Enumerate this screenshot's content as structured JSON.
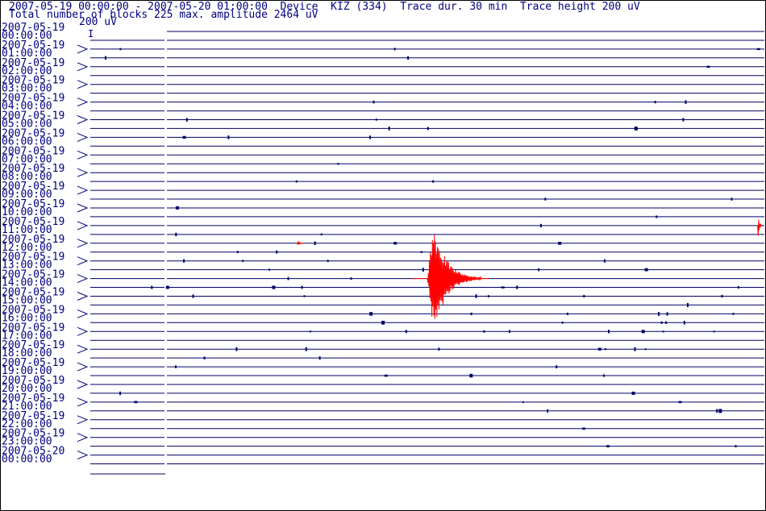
{
  "header": {
    "line1": "2007-05-19 00:00:00 - 2007-05-20 01:00:00  Device  KIZ (334)  Trace dur. 30 min  Trace height 200 uV",
    "line2": "Total number of blocks 225 max. amplitude 2464 uV"
  },
  "scale": {
    "label": "200 uV",
    "marker": "I"
  },
  "colors": {
    "trace": "#000066",
    "event": "#ff0000",
    "text": "#000080",
    "frame": "#000000"
  },
  "chart_data": {
    "type": "line",
    "title": "",
    "xlabel": "",
    "ylabel": "",
    "trace_duration_min": 30,
    "trace_height_uV": 200,
    "hour_labels": [
      {
        "date": "2007-05-19",
        "time": "00:00:00"
      },
      {
        "date": "2007-05-19",
        "time": "01:00:00"
      },
      {
        "date": "2007-05-19",
        "time": "02:00:00"
      },
      {
        "date": "2007-05-19",
        "time": "03:00:00"
      },
      {
        "date": "2007-05-19",
        "time": "04:00:00"
      },
      {
        "date": "2007-05-19",
        "time": "05:00:00"
      },
      {
        "date": "2007-05-19",
        "time": "06:00:00"
      },
      {
        "date": "2007-05-19",
        "time": "07:00:00"
      },
      {
        "date": "2007-05-19",
        "time": "08:00:00"
      },
      {
        "date": "2007-05-19",
        "time": "09:00:00"
      },
      {
        "date": "2007-05-19",
        "time": "10:00:00"
      },
      {
        "date": "2007-05-19",
        "time": "11:00:00"
      },
      {
        "date": "2007-05-19",
        "time": "12:00:00"
      },
      {
        "date": "2007-05-19",
        "time": "13:00:00"
      },
      {
        "date": "2007-05-19",
        "time": "14:00:00"
      },
      {
        "date": "2007-05-19",
        "time": "15:00:00"
      },
      {
        "date": "2007-05-19",
        "time": "16:00:00"
      },
      {
        "date": "2007-05-19",
        "time": "17:00:00"
      },
      {
        "date": "2007-05-19",
        "time": "18:00:00"
      },
      {
        "date": "2007-05-19",
        "time": "19:00:00"
      },
      {
        "date": "2007-05-19",
        "time": "20:00:00"
      },
      {
        "date": "2007-05-19",
        "time": "21:00:00"
      },
      {
        "date": "2007-05-19",
        "time": "22:00:00"
      },
      {
        "date": "2007-05-19",
        "time": "23:00:00"
      },
      {
        "date": "2007-05-20",
        "time": "00:00:00"
      }
    ],
    "events": [
      {
        "trace": 24,
        "minute": 9.2,
        "amplitude_uV": 60,
        "duration_min": 0.3
      },
      {
        "trace": 28,
        "minute": 15.0,
        "amplitude_uV": 2464,
        "duration_min": 2.4
      },
      {
        "trace": 22,
        "minute": 29.7,
        "amplitude_uV": 300,
        "duration_min": 0.2
      }
    ]
  }
}
